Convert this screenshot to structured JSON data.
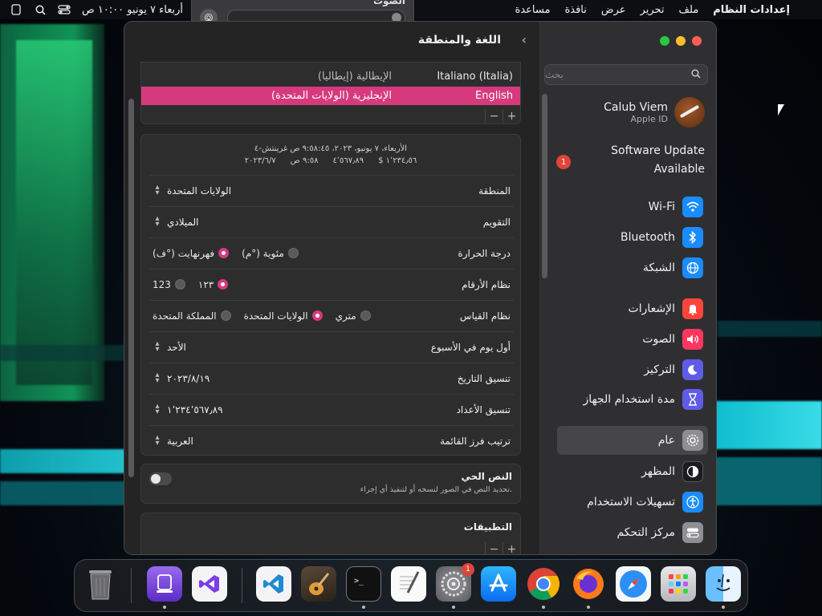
{
  "menubar": {
    "app_name": "إعدادات النظام",
    "items": [
      "ملف",
      "تحرير",
      "عرض",
      "نافذة",
      "مساعدة"
    ],
    "clock": "أربعاء ٧ يونيو ١٠:٠٠ ص"
  },
  "sound_popover": {
    "title": "الصوت"
  },
  "window": {
    "title": "اللغة والمنطقة",
    "search_placeholder": "بحث",
    "account": {
      "name": "Calub Viem",
      "sub": "Apple ID"
    },
    "software_update": {
      "label_line1": "Software Update",
      "label_line2": "Available",
      "badge": "1"
    },
    "sidebar_items": [
      {
        "label": "Wi-Fi",
        "icon": "wifi-icon",
        "color": "#1a8cff"
      },
      {
        "label": "Bluetooth",
        "icon": "bluetooth-icon",
        "color": "#1a8cff"
      },
      {
        "label": "الشبكة",
        "icon": "globe-icon",
        "color": "#1a8cff"
      },
      {
        "label": "الإشعارات",
        "icon": "bell-icon",
        "color": "#ff453a"
      },
      {
        "label": "الصوت",
        "icon": "speaker-icon",
        "color": "#ff375f"
      },
      {
        "label": "التركيز",
        "icon": "moon-icon",
        "color": "#5e5ce6"
      },
      {
        "label": "مدة استخدام الجهاز",
        "icon": "hourglass-icon",
        "color": "#5e5ce6"
      },
      {
        "label": "عام",
        "icon": "gear-icon",
        "color": "#8e8e93"
      },
      {
        "label": "المظهر",
        "icon": "appearance-icon",
        "color": "#1c1c1e"
      },
      {
        "label": "تسهيلات الاستخدام",
        "icon": "accessibility-icon",
        "color": "#1a8cff"
      },
      {
        "label": "مركز التحكم",
        "icon": "control-center-icon",
        "color": "#8e8e93"
      }
    ],
    "languages": [
      {
        "native": "Italiano (Italia)",
        "arabic": "الإيطالية (إيطاليا)",
        "selected": false
      },
      {
        "native": "English",
        "arabic": "الإنجليزية (الولايات المتحدة)",
        "selected": true
      }
    ],
    "format_preview": {
      "line1": "الأربعاء، ٧ يونيو، ٢٠٢٣، ٩:٥٨:٤٥ ص غرينتش-٤",
      "date_short": "٢٠٢٣/٦/٧",
      "time_short": "٩:٥٨ ص",
      "number": "٤٬٥٦٧٫٨٩",
      "currency": "$ ١٬٢٣٤٫٥٦"
    },
    "rows": {
      "region": {
        "label": "المنطقة",
        "value": "الولايات المتحدة"
      },
      "calendar": {
        "label": "التقويم",
        "value": "الميلادي"
      },
      "temperature": {
        "label": "درجة الحرارة",
        "options": [
          "مئوية (°م)",
          "فهرنهايت (°ف)"
        ],
        "selected": "فهرنهايت (°ف)"
      },
      "numbering": {
        "label": "نظام الأرقام",
        "options": [
          "١٢٣",
          "123"
        ],
        "selected": "١٢٣"
      },
      "measurement": {
        "label": "نظام القياس",
        "options": [
          "متري",
          "الولايات المتحدة",
          "المملكة المتحدة"
        ],
        "selected": "الولايات المتحدة"
      },
      "first_day": {
        "label": "أول يوم في الأسبوع",
        "value": "الأحد"
      },
      "date_format": {
        "label": "تنسيق التاريخ",
        "value": "٢٠٢٣/٨/١٩"
      },
      "number_format": {
        "label": "تنسيق الأعداد",
        "value": "١٬٢٣٤٬٥٦٧٫٨٩"
      },
      "list_sort": {
        "label": "ترتيب فرز القائمة",
        "value": "العربية"
      }
    },
    "live_text": {
      "title": "النص الحي",
      "subtitle": "تحديد النص في الصور لنسخه أو لتنفيذ أي إجراء."
    },
    "apps": {
      "title": "التطبيقات"
    },
    "plus": "+",
    "minus": "−"
  },
  "dock": {
    "apps": [
      "Trash",
      "Simulator",
      "Visual Studio",
      "Visual Studio Code",
      "GarageBand",
      "Terminal",
      "TextEdit",
      "System Settings",
      "App Store",
      "Chrome",
      "Firefox",
      "Safari",
      "Launchpad",
      "Finder"
    ],
    "system_settings_badge": "1"
  }
}
